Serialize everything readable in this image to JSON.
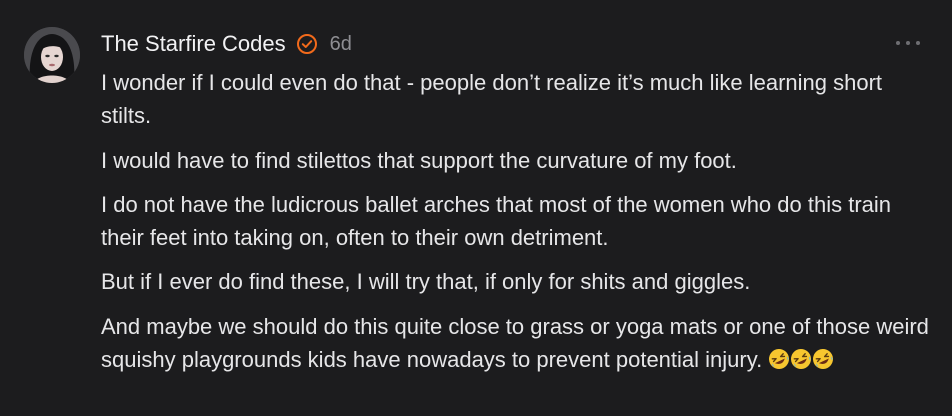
{
  "comment": {
    "author": "The Starfire Codes",
    "verified_icon": "verified-badge-icon",
    "verified_color": "#f26a1b",
    "time": "6d",
    "more_icon": "ellipsis-icon",
    "paragraphs": [
      "I wonder if I could even do that - people don’t realize it’s much like learning short stilts.",
      "I would have to find stilettos that support the curvature of my foot.",
      "I do not have the ludicrous ballet arches that most of the women who do this train their feet into taking on, often to their own detriment.",
      "But if I ever do find these, I will try that, if only for shits and giggles.",
      "And maybe we should do this quite close to grass or yoga mats or one of those weird squishy playgrounds kids have nowadays to prevent potential injury."
    ],
    "emoji_icon": "rolling-on-floor-laughing-emoji",
    "emoji_count": 3
  },
  "colors": {
    "background": "#1c1c1e",
    "text": "#e6e6e8",
    "muted": "#8e8e93"
  }
}
